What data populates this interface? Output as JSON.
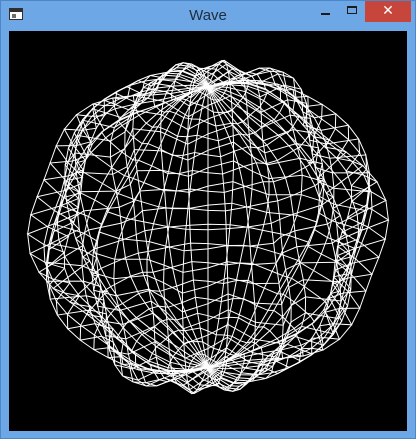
{
  "window": {
    "title": "Wave",
    "controls": {
      "minimize_icon": "minimize-icon",
      "maximize_icon": "maximize-icon",
      "close_icon": "close-icon",
      "close_glyph": "✕"
    }
  },
  "canvas": {
    "background_color": "#000000",
    "stroke_color": "#ffffff",
    "mesh": "wireframe-wavy-sphere"
  },
  "colors": {
    "frame": "#6ea7e6",
    "close_button": "#c7463c"
  }
}
